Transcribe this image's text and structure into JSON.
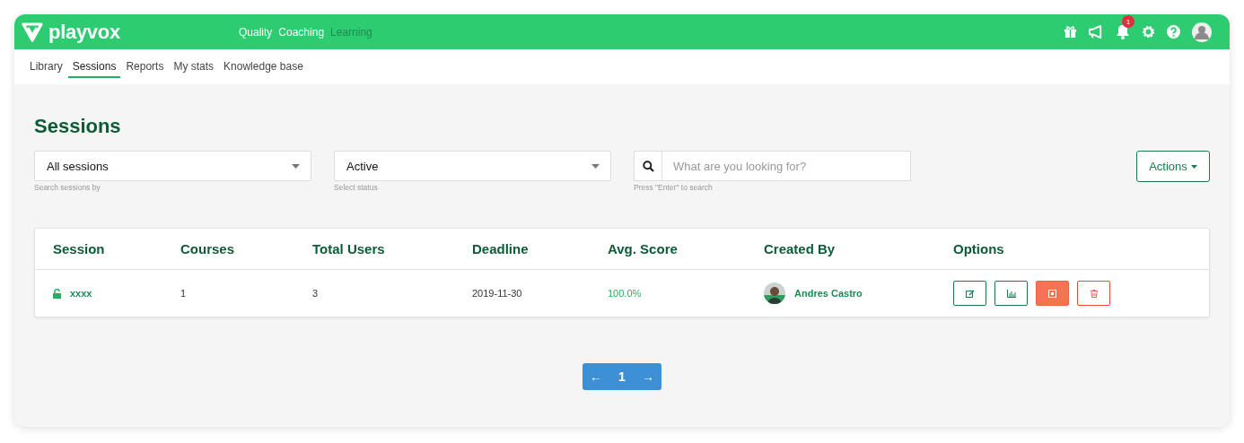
{
  "brand": "playvox",
  "nav": [
    {
      "label": "Quality",
      "disabled": false
    },
    {
      "label": "Coaching",
      "disabled": false
    },
    {
      "label": "Learning",
      "disabled": true
    }
  ],
  "notifications": {
    "count": "1"
  },
  "subnav": [
    {
      "label": "Library",
      "selected": false
    },
    {
      "label": "Sessions",
      "selected": true
    },
    {
      "label": "Reports",
      "selected": false
    },
    {
      "label": "My stats",
      "selected": false
    },
    {
      "label": "Knowledge base",
      "selected": false
    }
  ],
  "page_title": "Sessions",
  "filters": [
    {
      "value": "All sessions",
      "hint": "Search sessions by"
    },
    {
      "value": "Active",
      "hint": "Select status"
    }
  ],
  "search": {
    "placeholder": "What are you looking for?",
    "hint": "Press \"Enter\" to search"
  },
  "actions_button": "Actions",
  "table": {
    "columns": [
      "Session",
      "Courses",
      "Total Users",
      "Deadline",
      "Avg. Score",
      "Created By",
      "Options"
    ],
    "rows": [
      {
        "session": "xxxx",
        "locked": false,
        "courses": "1",
        "total_users": "3",
        "deadline": "2019-11-30",
        "avg_score": "100.0%",
        "created_by": "Andres Castro",
        "options": [
          {
            "kind": "edit"
          },
          {
            "kind": "stats"
          },
          {
            "kind": "stop"
          },
          {
            "kind": "delete"
          }
        ]
      }
    ]
  },
  "pagination": {
    "prev": "←",
    "pages": [
      {
        "label": "1",
        "selected": true
      }
    ],
    "next": "→"
  }
}
